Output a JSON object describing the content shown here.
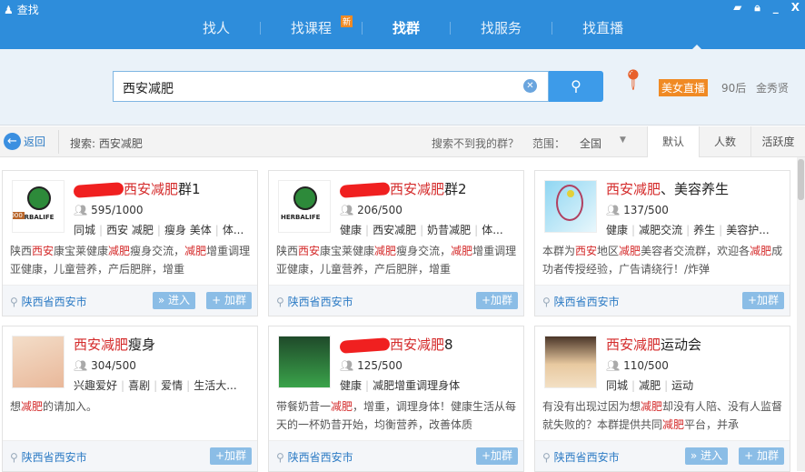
{
  "window": {
    "title": "查找",
    "controls": [
      "feedback",
      "lock",
      "minimize",
      "close"
    ]
  },
  "nav": {
    "tabs": [
      {
        "label": "找人"
      },
      {
        "label": "找课程",
        "badge": "新"
      },
      {
        "label": "找群",
        "active": true
      },
      {
        "label": "找服务"
      },
      {
        "label": "找直播"
      }
    ]
  },
  "search": {
    "value": "西安减肥",
    "hot": {
      "live": "美女直播",
      "item1": "90后",
      "item2": "金秀贤"
    }
  },
  "filter": {
    "back": "返回",
    "query": "搜索: 西安减肥",
    "not_found": "搜索不到我的群？",
    "range_label": "范围：",
    "range_value": "全国",
    "sort": [
      "默认",
      "人数",
      "活跃度"
    ]
  },
  "colors": {
    "brand": "#2e8ddb",
    "highlight": "#d42a2a",
    "button": "#8bbde6"
  },
  "cards": [
    {
      "avatar": "herbalife",
      "level": "1000",
      "redacted": true,
      "name_hl": "西安减肥",
      "name_rest": "群1",
      "count": "595/1000",
      "tags": [
        "同城",
        "西安 减肥",
        "瘦身 美体",
        "体..."
      ],
      "desc": [
        [
          "陕西",
          0
        ],
        [
          "西安",
          1
        ],
        [
          "康宝莱健康",
          0
        ],
        [
          "减肥",
          1
        ],
        [
          "瘦身交流，",
          0
        ],
        [
          "减肥",
          1
        ],
        [
          "增重调理亚健康，儿童营养，产后肥胖，增重",
          0
        ]
      ],
      "location": "陕西省西安市",
      "buttons": [
        "» 进入",
        "+ 加群"
      ]
    },
    {
      "avatar": "herbalife",
      "redacted": true,
      "name_hl": "西安减肥",
      "name_rest": "群2",
      "count": "206/500",
      "tags": [
        "健康",
        "西安减肥",
        "奶昔减肥",
        "体..."
      ],
      "desc": [
        [
          "陕西",
          0
        ],
        [
          "西安",
          1
        ],
        [
          "康宝莱健康",
          0
        ],
        [
          "减肥",
          1
        ],
        [
          "瘦身交流，",
          0
        ],
        [
          "减肥",
          1
        ],
        [
          "增重调理亚健康，儿童营养，产后肥胖，增重",
          0
        ]
      ],
      "location": "陕西省西安市",
      "buttons": [
        "+加群"
      ]
    },
    {
      "avatar": "racket",
      "name_hl": "西安减肥",
      "name_rest": "、美容养生",
      "count": "137/500",
      "tags": [
        "健康",
        "减肥交流",
        "养生",
        "美容护..."
      ],
      "desc": [
        [
          "本群为",
          0
        ],
        [
          "西安",
          1
        ],
        [
          "地区",
          0
        ],
        [
          "减肥",
          1
        ],
        [
          "美容者交流群，欢迎各",
          0
        ],
        [
          "减肥",
          1
        ],
        [
          "成功者传授经验，广告请绕行！/炸弹",
          0
        ]
      ],
      "location": "陕西省西安市",
      "buttons": [
        "+加群"
      ]
    },
    {
      "avatar": "dancer",
      "name_hl": "西安减肥",
      "name_rest": "瘦身",
      "count": "304/500",
      "tags": [
        "兴趣爱好",
        "喜剧",
        "爱情",
        "生活大..."
      ],
      "desc": [
        [
          "想",
          0
        ],
        [
          "减肥",
          1
        ],
        [
          "的请加入。",
          0
        ]
      ],
      "location": "陕西省西安市",
      "buttons": [
        "+加群"
      ]
    },
    {
      "avatar": "drink",
      "redacted": true,
      "name_hl": "西安减肥",
      "name_rest": "8",
      "count": "125/500",
      "tags": [
        "健康",
        "减肥增重调理身体"
      ],
      "desc": [
        [
          "带餐奶昔一",
          0
        ],
        [
          "减肥",
          1
        ],
        [
          "，增重，调理身体！健康生活从每天的一杯奶昔开始，均衡营养，改善体质",
          0
        ]
      ],
      "location": "陕西省西安市",
      "buttons": [
        "+加群"
      ]
    },
    {
      "avatar": "cat",
      "name_hl": "西安减肥",
      "name_rest": "运动会",
      "count": "110/500",
      "tags": [
        "同城",
        "减肥",
        "运动"
      ],
      "desc": [
        [
          "有没有出现过因为想",
          0
        ],
        [
          "减肥",
          1
        ],
        [
          "却没有人陪、没有人监督就失败的？本群提供共同",
          0
        ],
        [
          "减肥",
          1
        ],
        [
          "平台，并承",
          0
        ]
      ],
      "location": "陕西省西安市",
      "buttons": [
        "» 进入",
        "+ 加群"
      ]
    }
  ]
}
